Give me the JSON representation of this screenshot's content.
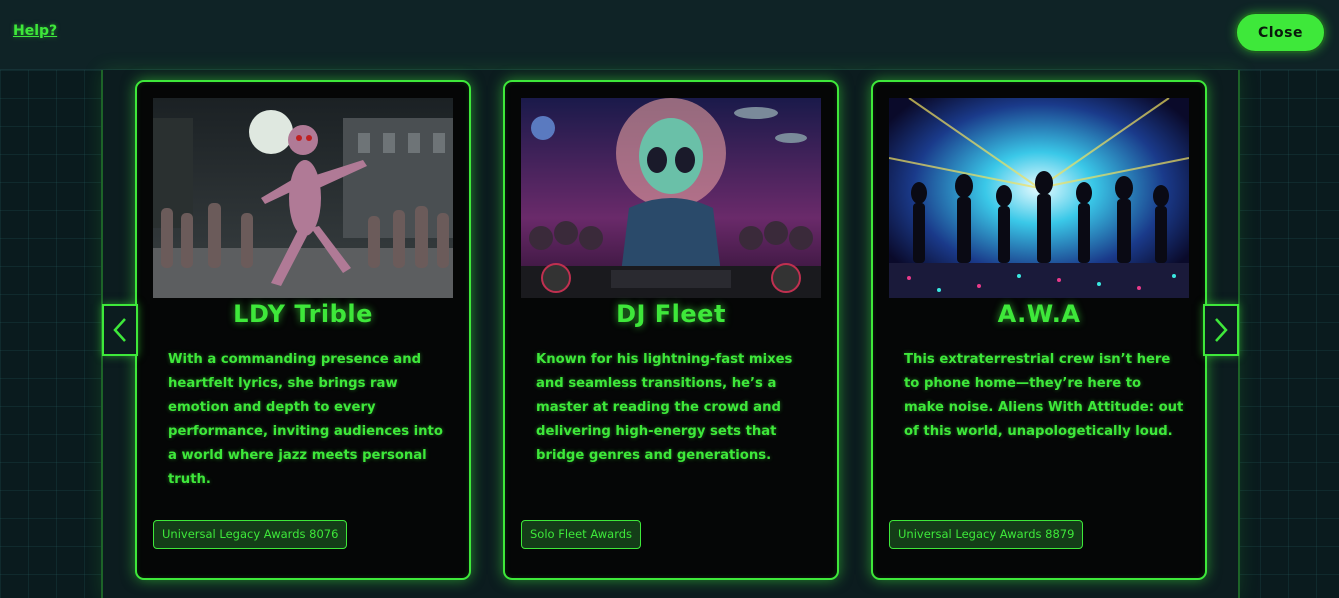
{
  "header": {
    "help_label": "Help?",
    "close_label": "Close"
  },
  "colors": {
    "accent": "#3ee83a",
    "background": "#0b1d20",
    "card_background": "#050606"
  },
  "navigation": {
    "prev_icon": "chevron-left-icon",
    "next_icon": "chevron-right-icon"
  },
  "cards": [
    {
      "title": "LDY Trible",
      "description": "With a commanding presence and heartfelt lyrics, she brings raw emotion and depth to every performance, inviting audiences into a world where jazz meets personal truth.",
      "award": "Universal Legacy Awards 8076",
      "image_subject": "alien dancing in night street crowd"
    },
    {
      "title": "DJ Fleet",
      "description": "Known for his lightning-fast mixes and seamless transitions, he’s a master at reading the crowd and delivering high-energy sets that bridge genres and generations.",
      "award": "Solo Fleet Awards",
      "image_subject": "alien DJ at turntables"
    },
    {
      "title": "A.W.A",
      "description": "This extraterrestrial crew isn’t here to phone home—they’re here to make noise. Aliens With Attitude: out of this world, unapologetically loud.",
      "award": "Universal Legacy Awards 8879",
      "image_subject": "silhouetted aliens dancing in neon lights"
    }
  ]
}
